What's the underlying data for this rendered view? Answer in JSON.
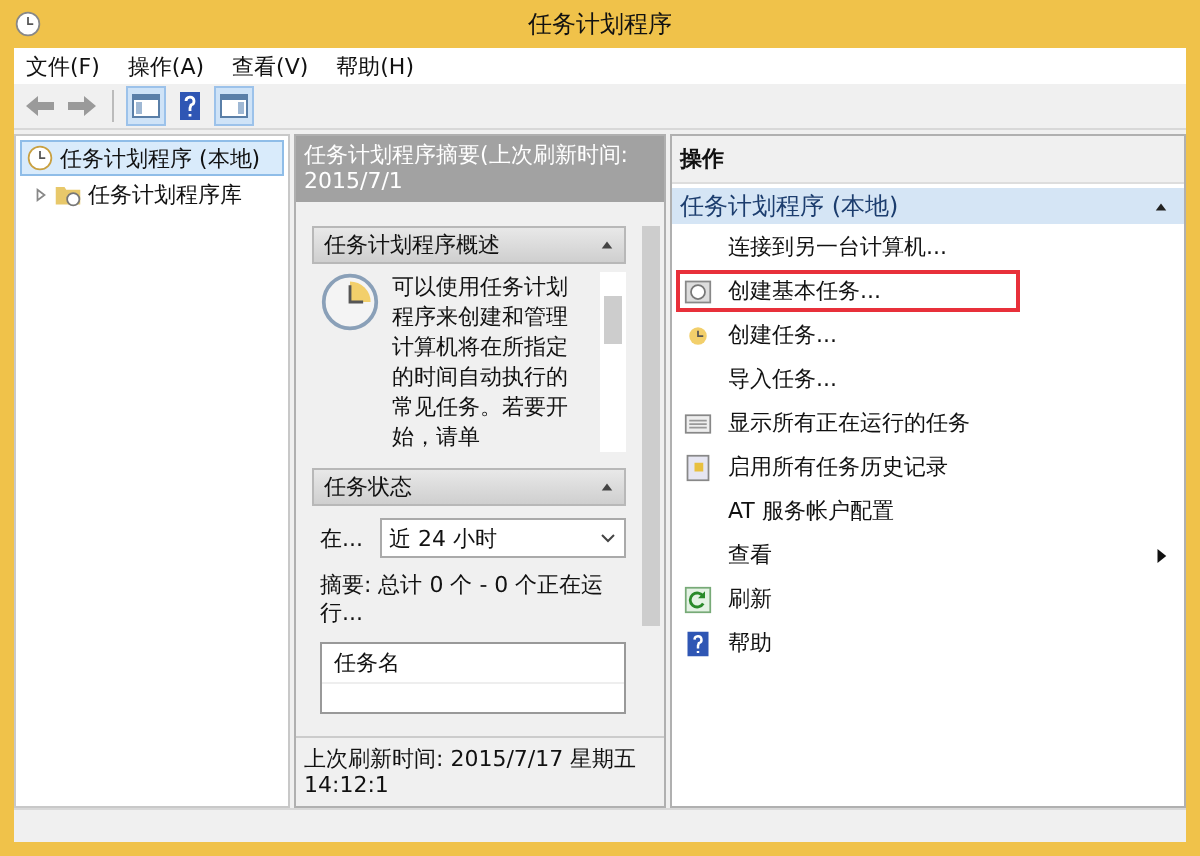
{
  "window": {
    "title": "任务计划程序"
  },
  "menu": [
    {
      "label": "文件(F)"
    },
    {
      "label": "操作(A)"
    },
    {
      "label": "查看(V)"
    },
    {
      "label": "帮助(H)"
    }
  ],
  "tree": [
    {
      "label": "任务计划程序 (本地)",
      "selected": true,
      "children": [
        {
          "label": "任务计划程序库",
          "selected": false,
          "expanded": false
        }
      ]
    }
  ],
  "summary_pane": {
    "header": "任务计划程序摘要(上次刷新时间: 2015/7/1",
    "overview": {
      "title": "任务计划程序概述",
      "text": "可以使用任务计划程序来创建和管理计算机将在所指定的时间自动执行的常见任务。若要开始，请单"
    },
    "status": {
      "title": "任务状态",
      "filter_label": "在...",
      "filter_value": "近 24 小时",
      "summary": "摘要: 总计 0 个 - 0 个正在运行...",
      "list_column": "任务名"
    },
    "last_refresh": "上次刷新时间: 2015/7/17 星期五 14:12:1"
  },
  "actions": {
    "header": "操作",
    "section": "任务计划程序 (本地)",
    "items": [
      {
        "label": "连接到另一台计算机...",
        "kind": "plain",
        "highlighted": false,
        "submenu": false
      },
      {
        "label": "创建基本任务...",
        "kind": "basic-task",
        "highlighted": true,
        "submenu": false
      },
      {
        "label": "创建任务...",
        "kind": "task",
        "highlighted": false,
        "submenu": false
      },
      {
        "label": "导入任务...",
        "kind": "plain",
        "highlighted": false,
        "submenu": false
      },
      {
        "label": "显示所有正在运行的任务",
        "kind": "running",
        "highlighted": false,
        "submenu": false
      },
      {
        "label": "启用所有任务历史记录",
        "kind": "history",
        "highlighted": false,
        "submenu": false
      },
      {
        "label": "AT 服务帐户配置",
        "kind": "plain",
        "highlighted": false,
        "submenu": false
      },
      {
        "label": "查看",
        "kind": "plain",
        "highlighted": false,
        "submenu": true
      },
      {
        "label": "刷新",
        "kind": "refresh",
        "highlighted": false,
        "submenu": false
      },
      {
        "label": "帮助",
        "kind": "help",
        "highlighted": false,
        "submenu": false
      }
    ]
  }
}
